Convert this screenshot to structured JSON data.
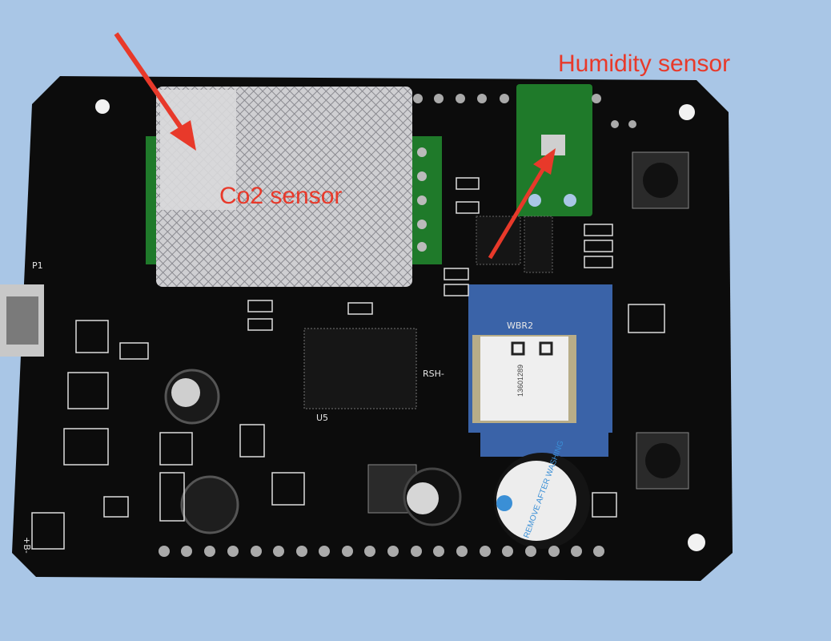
{
  "annotations": {
    "humidity_label": "Humidity sensor",
    "co2_label": "Co2 sensor",
    "arrow_color": "#e8392a"
  },
  "board": {
    "module_label": "WBR2",
    "board_name": "RSH-",
    "chip_label": "U5",
    "port_label": "P1",
    "power_label": "+B-",
    "buzzer_sticker": "REMOVE AFTER WASHING",
    "module_code": "13601289",
    "colors": {
      "pcb": "#0c0c0c",
      "module": "#3a63a8",
      "breakout": "#1f7a2a",
      "background": "#a9c6e6"
    }
  }
}
